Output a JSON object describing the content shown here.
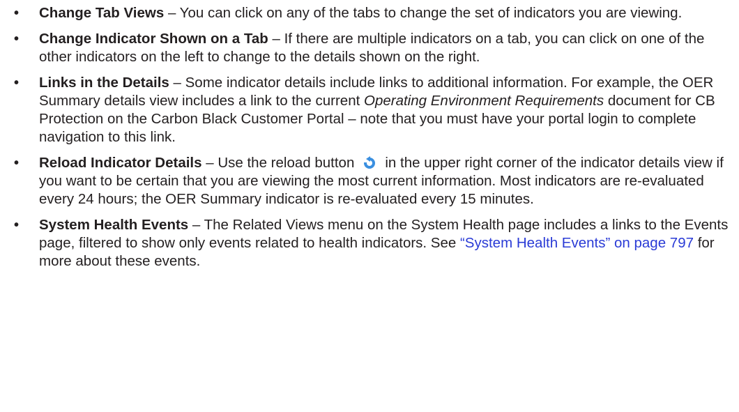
{
  "items": [
    {
      "bullet": "•",
      "term": "Change Tab Views",
      "text": " – You can click on any of the tabs to change the set of indicators you are viewing."
    },
    {
      "bullet": "•",
      "term": "Change Indicator Shown on a Tab",
      "text": " – If there are multiple indicators on a tab, you can click on one of the other indicators on the left to change to the details shown on the right."
    },
    {
      "bullet": "•",
      "term": "Links in the Details",
      "text_before": " – Some indicator details include links to additional information. For example, the OER Summary details view includes a link to the current ",
      "italic": "Operating Environment Requirements",
      "text_after": " document for CB Protection on the Carbon Black Customer Portal – note that you must have your portal login to complete navigation to this link."
    },
    {
      "bullet": "•",
      "term": "Reload Indicator Details",
      "text_before": " – Use the reload button",
      "icon": "reload-icon",
      "text_after": "in the upper right corner of the indicator details view if you want to be certain that you are viewing the most current information. Most indicators are re-evaluated every 24 hours; the OER Summary indicator is re-evaluated every 15 minutes."
    },
    {
      "bullet": "•",
      "term": "System Health Events",
      "text_before": " – The Related Views menu on the System Health page includes a links to the Events page, filtered to show only events related to health indicators. See ",
      "link": "“System Health Events” on page 797",
      "text_after": " for more about these events."
    }
  ],
  "colors": {
    "text": "#231f20",
    "link": "#2a3bd6",
    "icon": "#3a8fe0"
  }
}
